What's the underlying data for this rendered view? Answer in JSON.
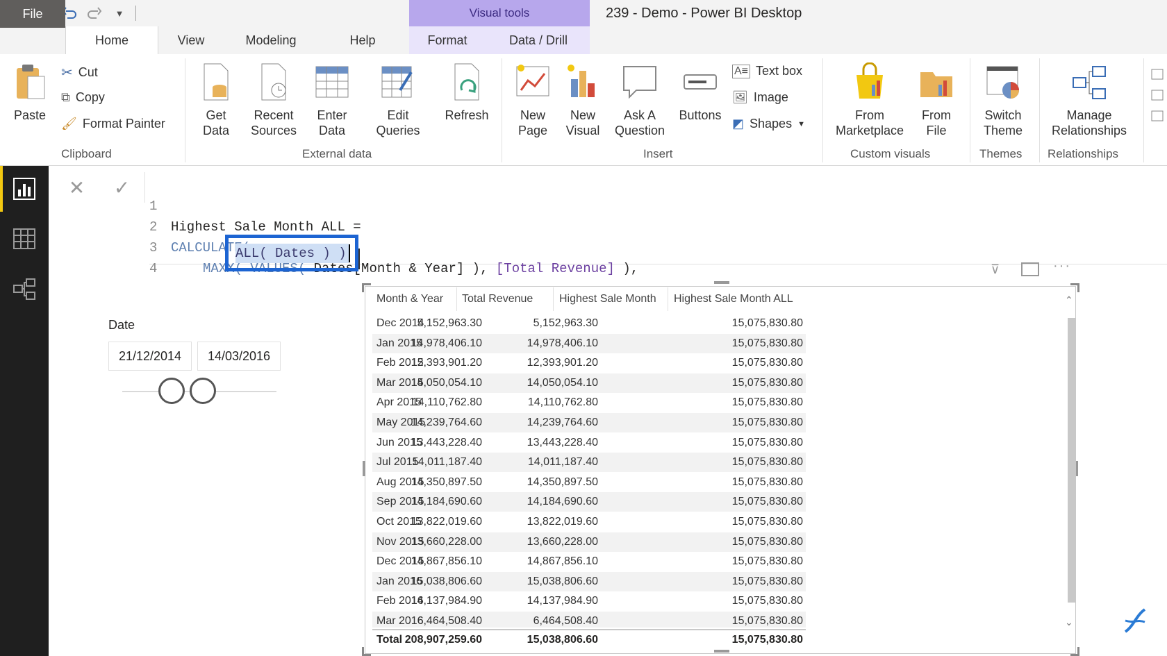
{
  "title_bar": {
    "contextual_tab": "Visual tools",
    "window_title": "239 - Demo - Power BI Desktop"
  },
  "tabs": [
    "File",
    "Home",
    "View",
    "Modeling",
    "Help",
    "Format",
    "Data / Drill"
  ],
  "ribbon": {
    "clipboard": {
      "paste": "Paste",
      "cut": "Cut",
      "copy": "Copy",
      "format_painter": "Format Painter",
      "group": "Clipboard"
    },
    "external_data": {
      "get_data": "Get Data",
      "recent_sources": "Recent Sources",
      "enter_data": "Enter Data",
      "edit_queries": "Edit Queries",
      "refresh": "Refresh",
      "group": "External data"
    },
    "insert": {
      "new_page": "New Page",
      "new_visual": "New Visual",
      "ask_question": "Ask A Question",
      "buttons": "Buttons",
      "text_box": "Text box",
      "image": "Image",
      "shapes": "Shapes",
      "group": "Insert"
    },
    "custom_visuals": {
      "from_marketplace": "From Marketplace",
      "from_file": "From File",
      "group": "Custom visuals"
    },
    "themes": {
      "switch_theme": "Switch Theme",
      "group": "Themes"
    },
    "relationships": {
      "manage": "Manage Relationships",
      "group": "Relationships"
    }
  },
  "formula": {
    "line1": "Highest Sale Month ALL =",
    "line2": "CALCULATE(",
    "line3_fn": "MAXX( VALUES( ",
    "line3_col": "Dates[Month & Year] ), ",
    "line3_measure": "[Total Revenue]",
    "line3_end": " ),",
    "line4": "ALL( Dates ) )"
  },
  "slicer": {
    "title": "Date",
    "start": "21/12/2014",
    "end": "14/03/2016"
  },
  "table": {
    "headers": [
      "Month & Year",
      "Total Revenue",
      "Highest Sale Month",
      "Highest Sale Month ALL"
    ],
    "rows": [
      [
        "Dec 2014",
        "5,152,963.30",
        "5,152,963.30",
        "15,075,830.80"
      ],
      [
        "Jan 2015",
        "14,978,406.10",
        "14,978,406.10",
        "15,075,830.80"
      ],
      [
        "Feb 2015",
        "12,393,901.20",
        "12,393,901.20",
        "15,075,830.80"
      ],
      [
        "Mar 2015",
        "14,050,054.10",
        "14,050,054.10",
        "15,075,830.80"
      ],
      [
        "Apr 2015",
        "14,110,762.80",
        "14,110,762.80",
        "15,075,830.80"
      ],
      [
        "May 2015",
        "14,239,764.60",
        "14,239,764.60",
        "15,075,830.80"
      ],
      [
        "Jun 2015",
        "13,443,228.40",
        "13,443,228.40",
        "15,075,830.80"
      ],
      [
        "Jul 2015",
        "14,011,187.40",
        "14,011,187.40",
        "15,075,830.80"
      ],
      [
        "Aug 2015",
        "14,350,897.50",
        "14,350,897.50",
        "15,075,830.80"
      ],
      [
        "Sep 2015",
        "14,184,690.60",
        "14,184,690.60",
        "15,075,830.80"
      ],
      [
        "Oct 2015",
        "13,822,019.60",
        "13,822,019.60",
        "15,075,830.80"
      ],
      [
        "Nov 2015",
        "13,660,228.00",
        "13,660,228.00",
        "15,075,830.80"
      ],
      [
        "Dec 2015",
        "14,867,856.10",
        "14,867,856.10",
        "15,075,830.80"
      ],
      [
        "Jan 2016",
        "15,038,806.60",
        "15,038,806.60",
        "15,075,830.80"
      ],
      [
        "Feb 2016",
        "14,137,984.90",
        "14,137,984.90",
        "15,075,830.80"
      ],
      [
        "Mar 2016",
        "6,464,508.40",
        "6,464,508.40",
        "15,075,830.80"
      ]
    ],
    "total": [
      "Total",
      "208,907,259.60",
      "15,038,806.60",
      "15,075,830.80"
    ]
  },
  "colors": {
    "accent": "#f2c811",
    "selection": "#1c64d2",
    "contextual": "#b7a7ec"
  }
}
